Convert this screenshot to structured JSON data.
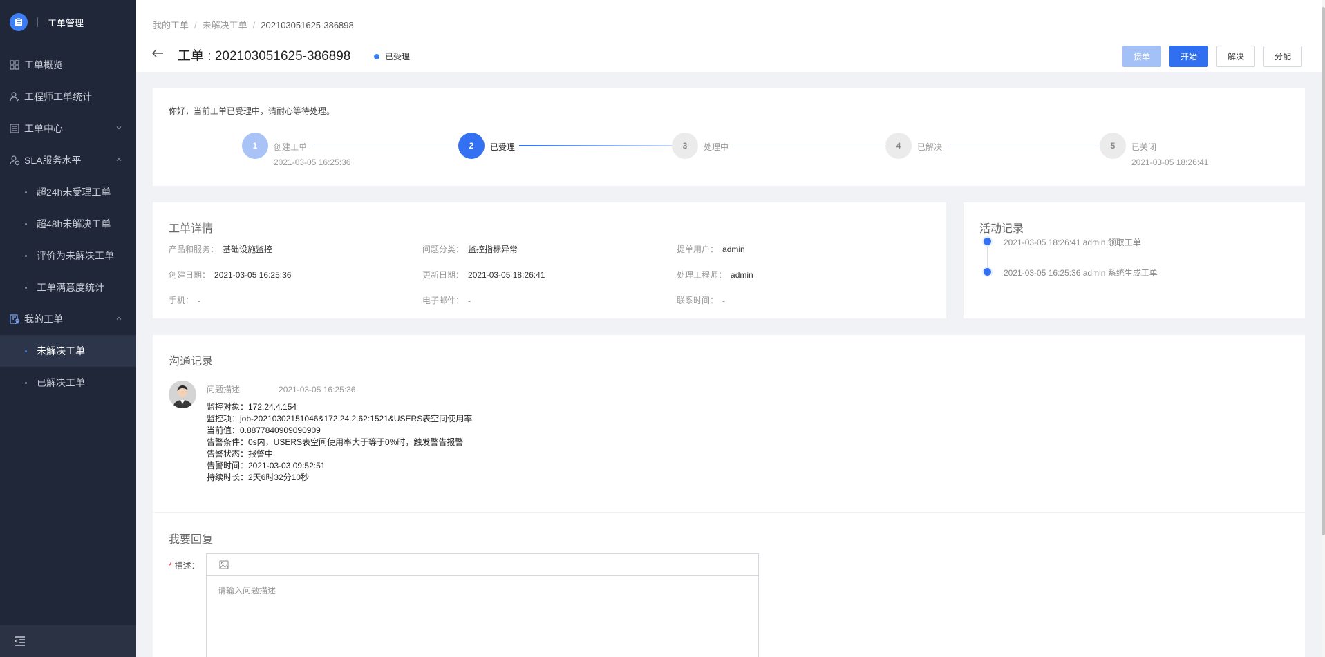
{
  "sidebar": {
    "brand_title": "工单管理",
    "items": [
      {
        "label": "工单概览"
      },
      {
        "label": "工程师工单统计"
      },
      {
        "label": "工单中心"
      },
      {
        "label": "SLA服务水平"
      }
    ],
    "sla_sub": [
      {
        "label": "超24h未受理工单"
      },
      {
        "label": "超48h未解决工单"
      },
      {
        "label": "评价为未解决工单"
      },
      {
        "label": "工单满意度统计"
      }
    ],
    "my_orders": {
      "label": "我的工单"
    },
    "my_sub": [
      {
        "label": "未解决工单"
      },
      {
        "label": "已解决工单"
      }
    ]
  },
  "header": {
    "breadcrumb": [
      "我的工单",
      "未解决工单",
      "202103051625-386898"
    ],
    "title": "工单 : 202103051625-386898",
    "status": "已受理",
    "buttons": {
      "accept": "接单",
      "start": "开始",
      "resolve": "解决",
      "assign": "分配"
    }
  },
  "progress": {
    "notice": "你好，当前工单已受理中，请耐心等待处理。",
    "steps": [
      {
        "num": "1",
        "label": "创建工单",
        "time": "2021-03-05 16:25:36"
      },
      {
        "num": "2",
        "label": "已受理",
        "time": ""
      },
      {
        "num": "3",
        "label": "处理中",
        "time": ""
      },
      {
        "num": "4",
        "label": "已解决",
        "time": ""
      },
      {
        "num": "5",
        "label": "已关闭",
        "time": "2021-03-05 18:26:41"
      }
    ]
  },
  "details": {
    "title": "工单详情",
    "fields": [
      {
        "k": "产品和服务：",
        "v": "基础设施监控"
      },
      {
        "k": "问题分类：",
        "v": "监控指标异常"
      },
      {
        "k": "提单用户：",
        "v": "admin"
      },
      {
        "k": "创建日期：",
        "v": "2021-03-05 16:25:36"
      },
      {
        "k": "更新日期：",
        "v": "2021-03-05 18:26:41"
      },
      {
        "k": "处理工程师：",
        "v": "admin"
      },
      {
        "k": "手机：",
        "v": "-"
      },
      {
        "k": "电子邮件：",
        "v": "-"
      },
      {
        "k": "联系时间：",
        "v": "-"
      }
    ]
  },
  "activity": {
    "title": "活动记录",
    "entries": [
      "2021-03-05 18:26:41 admin 领取工单",
      "2021-03-05 16:25:36 admin 系统生成工单"
    ]
  },
  "communication": {
    "title": "沟通记录",
    "label": "问题描述",
    "time": "2021-03-05 16:25:36",
    "lines": [
      "监控对象：172.24.4.154",
      "监控项：job-20210302151046&172.24.2.62:1521&USERS表空间使用率",
      "当前值：0.8877840909090909",
      "告警条件：0s内，USERS表空间使用率大于等于0%时，触发警告报警",
      "告警状态：报警中",
      "告警时间：2021-03-03 09:52:51",
      "持续时长：2天6时32分10秒"
    ]
  },
  "reply": {
    "title": "我要回复",
    "required_mark": "*",
    "label": "描述：",
    "placeholder": "请输入问题描述"
  },
  "colors": {
    "accent": "#2f6ff0",
    "sidebar_bg": "#1f2739",
    "disabled": "#a3c0f7"
  }
}
